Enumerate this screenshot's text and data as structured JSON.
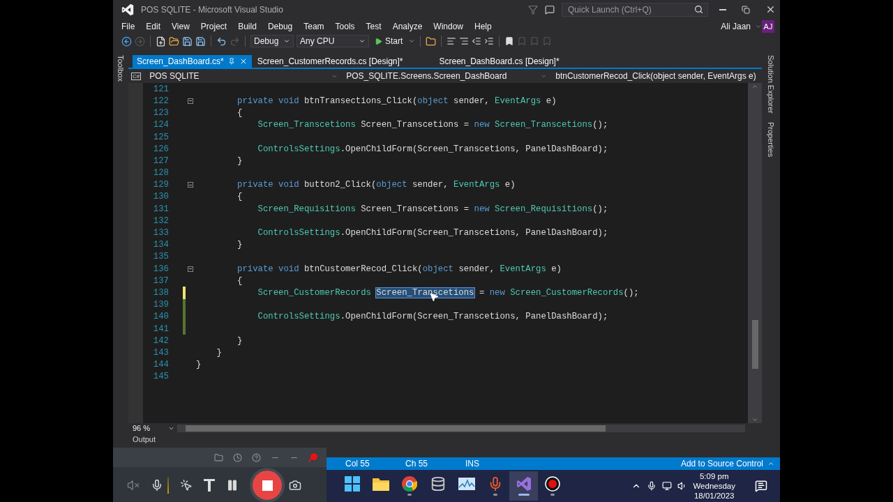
{
  "window": {
    "title": "POS SQLITE - Microsoft Visual Studio"
  },
  "quick_launch": {
    "placeholder": "Quick Launch (Ctrl+Q)"
  },
  "menu": [
    "File",
    "Edit",
    "View",
    "Project",
    "Build",
    "Debug",
    "Team",
    "Tools",
    "Test",
    "Analyze",
    "Window",
    "Help"
  ],
  "account": {
    "name": "Ali Jaan",
    "initials": "AJ"
  },
  "toolbar": {
    "configuration": "Debug",
    "platform": "Any CPU",
    "start": "Start"
  },
  "side_tabs_left": [
    "Toolbox"
  ],
  "side_tabs_right": [
    "Solution Explorer",
    "Properties"
  ],
  "tabs": [
    {
      "label": "Screen_DashBoard.cs*",
      "selected": true
    },
    {
      "label": "Screen_CustomerRecords.cs [Design]*",
      "selected": false
    },
    {
      "label": "Screen_DashBoard.cs [Design]*",
      "selected": false
    }
  ],
  "nav_bar": {
    "language_badge": "C#",
    "project": "POS SQLITE",
    "class": "POS_SQLITE.Screens.Screen_DashBoard",
    "member": "btnCustomerRecod_Click(object sender, EventArgs e)"
  },
  "code_lines": [
    {
      "number": "121",
      "fold": false
    },
    {
      "number": "122",
      "fold": true,
      "segments": [
        {
          "kind": "keyword",
          "text": "        private"
        },
        {
          "kind": "keyword",
          "text": " void"
        },
        {
          "kind": "plain",
          "text": " btnTransections_Click("
        },
        {
          "kind": "keyword",
          "text": "object"
        },
        {
          "kind": "plain",
          "text": " sender, "
        },
        {
          "kind": "type",
          "text": "EventArgs"
        },
        {
          "kind": "plain",
          "text": " e)"
        }
      ]
    },
    {
      "number": "123",
      "fold": false,
      "segments": [
        {
          "kind": "plain",
          "text": "        {"
        }
      ]
    },
    {
      "number": "124",
      "fold": false,
      "segments": [
        {
          "kind": "type",
          "text": "            Screen_Transcetions"
        },
        {
          "kind": "plain",
          "text": " Screen_Transcetions = "
        },
        {
          "kind": "keyword",
          "text": "new"
        },
        {
          "kind": "type",
          "text": " Screen_Transcetions"
        },
        {
          "kind": "plain",
          "text": "();"
        }
      ]
    },
    {
      "number": "125",
      "fold": false
    },
    {
      "number": "126",
      "fold": false,
      "segments": [
        {
          "kind": "type",
          "text": "            ControlsSettings"
        },
        {
          "kind": "plain",
          "text": ".OpenChildForm(Screen_Transcetions, PanelDashBoard);"
        }
      ]
    },
    {
      "number": "127",
      "fold": false,
      "segments": [
        {
          "kind": "plain",
          "text": "        }"
        }
      ]
    },
    {
      "number": "128",
      "fold": false
    },
    {
      "number": "129",
      "fold": true,
      "segments": [
        {
          "kind": "keyword",
          "text": "        private"
        },
        {
          "kind": "keyword",
          "text": " void"
        },
        {
          "kind": "plain",
          "text": " button2_Click("
        },
        {
          "kind": "keyword",
          "text": "object"
        },
        {
          "kind": "plain",
          "text": " sender, "
        },
        {
          "kind": "type",
          "text": "EventArgs"
        },
        {
          "kind": "plain",
          "text": " e)"
        }
      ]
    },
    {
      "number": "130",
      "fold": false,
      "segments": [
        {
          "kind": "plain",
          "text": "        {"
        }
      ]
    },
    {
      "number": "131",
      "fold": false,
      "segments": [
        {
          "kind": "type",
          "text": "            Screen_Requisitions"
        },
        {
          "kind": "plain",
          "text": " Screen_Transcetions = "
        },
        {
          "kind": "keyword",
          "text": "new"
        },
        {
          "kind": "type",
          "text": " Screen_Requisitions"
        },
        {
          "kind": "plain",
          "text": "();"
        }
      ]
    },
    {
      "number": "132",
      "fold": false
    },
    {
      "number": "133",
      "fold": false,
      "segments": [
        {
          "kind": "type",
          "text": "            ControlsSettings"
        },
        {
          "kind": "plain",
          "text": ".OpenChildForm(Screen_Transcetions, PanelDashBoard);"
        }
      ]
    },
    {
      "number": "134",
      "fold": false,
      "segments": [
        {
          "kind": "plain",
          "text": "        }"
        }
      ]
    },
    {
      "number": "135",
      "fold": false
    },
    {
      "number": "136",
      "fold": true,
      "segments": [
        {
          "kind": "keyword",
          "text": "        private"
        },
        {
          "kind": "keyword",
          "text": " void"
        },
        {
          "kind": "plain",
          "text": " btnCustomerRecod_Click("
        },
        {
          "kind": "keyword",
          "text": "object"
        },
        {
          "kind": "plain",
          "text": " sender, "
        },
        {
          "kind": "type",
          "text": "EventArgs"
        },
        {
          "kind": "plain",
          "text": " e)"
        }
      ]
    },
    {
      "number": "137",
      "fold": false,
      "segments": [
        {
          "kind": "plain",
          "text": "        {"
        }
      ]
    },
    {
      "number": "138",
      "fold": false,
      "color": "#efe272",
      "segments": [
        {
          "kind": "type",
          "text": "            Screen_CustomerRecords"
        },
        {
          "kind": "selected",
          "text": "Screen_Transcetions"
        },
        {
          "kind": "plain",
          "text": " = "
        },
        {
          "kind": "keyword",
          "text": "new"
        },
        {
          "kind": "type",
          "text": " Screen_CustomerRecords"
        },
        {
          "kind": "plain",
          "text": "();"
        }
      ]
    },
    {
      "number": "139",
      "fold": false,
      "color": "#577430"
    },
    {
      "number": "140",
      "fold": false,
      "color": "#577430",
      "segments": [
        {
          "kind": "type",
          "text": "            ControlsSettings"
        },
        {
          "kind": "plain",
          "text": ".OpenChildForm(Screen_Transcetions, PanelDashBoard);"
        }
      ]
    },
    {
      "number": "141",
      "fold": false,
      "color": "#577430"
    },
    {
      "number": "142",
      "fold": false,
      "segments": [
        {
          "kind": "plain",
          "text": "        }"
        }
      ]
    },
    {
      "number": "143",
      "fold": false,
      "segments": [
        {
          "kind": "plain",
          "text": "    }"
        }
      ]
    },
    {
      "number": "144",
      "fold": false,
      "segments": [
        {
          "kind": "plain",
          "text": "}"
        }
      ]
    },
    {
      "number": "145",
      "fold": false
    }
  ],
  "zoom": "96 %",
  "output_label": "Output",
  "status_bar": {
    "items": [
      "Col 55",
      "Ch 55",
      "INS"
    ],
    "source_control": "Add to Source Control"
  },
  "taskbar": {
    "apps": [
      {
        "kind": "start",
        "running": false,
        "selected": false
      },
      {
        "kind": "explorer",
        "running": false,
        "selected": false
      },
      {
        "kind": "chrome",
        "running": true,
        "selected": false
      },
      {
        "kind": "database",
        "running": false,
        "selected": false
      },
      {
        "kind": "monitor",
        "running": false,
        "selected": false
      },
      {
        "kind": "mic",
        "running": true,
        "selected": false
      },
      {
        "kind": "visualstudio",
        "running": true,
        "selected": true
      },
      {
        "kind": "recorder",
        "running": true,
        "selected": false
      }
    ],
    "time": "5:09 pm",
    "day": "Wednesday",
    "date": "18/01/2023"
  }
}
